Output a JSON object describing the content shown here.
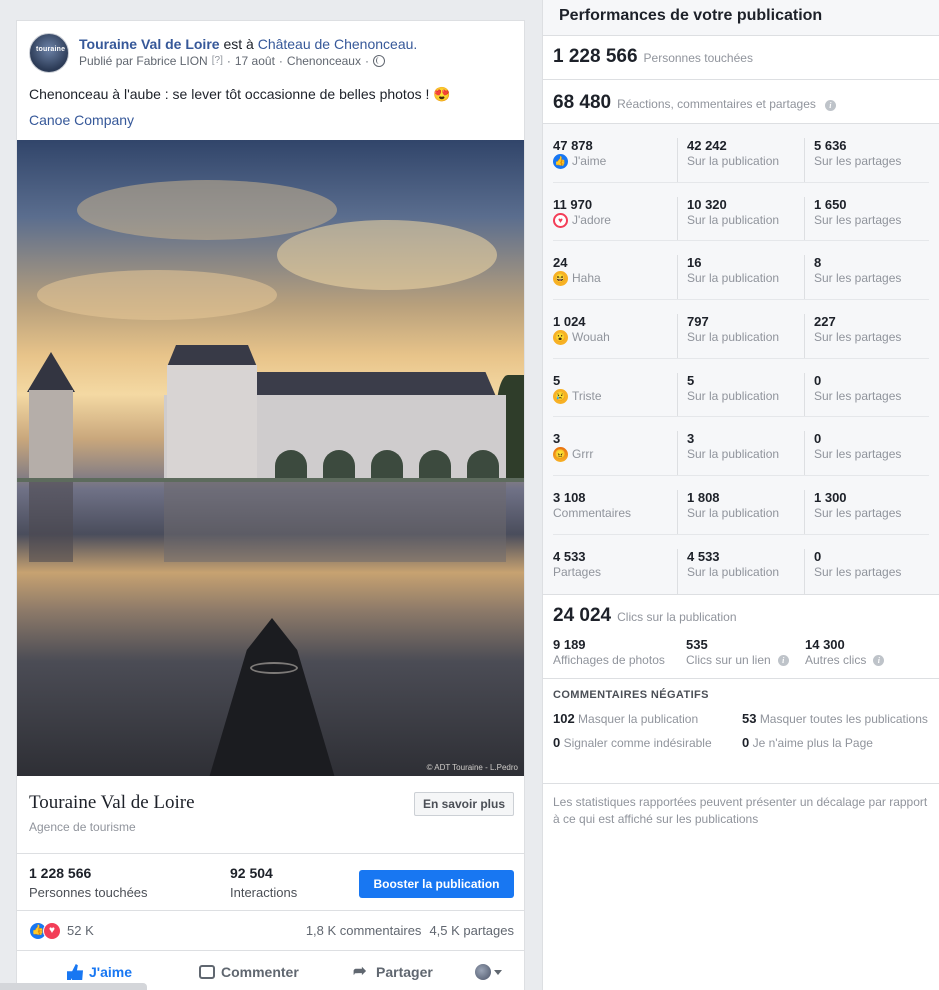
{
  "post": {
    "page_name": "Touraine Val de Loire",
    "avatar_text": "touraine",
    "is_at": "est à",
    "location": "Château de Chenonceau.",
    "published_by": "Publié par Fabrice LION",
    "question_mark": "[?]",
    "date": "17 août",
    "place": "Chenonceaux",
    "sep": "·",
    "message": "Chenonceau à l'aube : se lever tôt occasionne de belles photos ! 😍",
    "tagged": "Canoe Company",
    "photo_credit": "© ADT Touraine - L.Pedro",
    "cta": {
      "name": "Touraine Val de Loire",
      "category": "Agence de tourisme",
      "button": "En savoir plus"
    },
    "stats": {
      "reach_value": "1 228 566",
      "reach_label": "Personnes touchées",
      "interactions_value": "92 504",
      "interactions_label": "Interactions",
      "boost_button": "Booster la publication"
    },
    "reactions": {
      "count": "52 K",
      "comments": "1,8 K commentaires",
      "shares": "4,5 K partages"
    },
    "actions": {
      "like": "J'aime",
      "comment": "Commenter",
      "share": "Partager"
    }
  },
  "panel": {
    "title": "Performances de votre publication",
    "reach": {
      "value": "1 228 566",
      "label": "Personnes touchées"
    },
    "engagement": {
      "value": "68 480",
      "label": "Réactions, commentaires et partages"
    },
    "rows": [
      {
        "total": "47 878",
        "label": "J'aime",
        "icon": "like",
        "on_post": "42 242",
        "on_shares": "5 636"
      },
      {
        "total": "11 970",
        "label": "J'adore",
        "icon": "love",
        "on_post": "10 320",
        "on_shares": "1 650"
      },
      {
        "total": "24",
        "label": "Haha",
        "icon": "haha",
        "on_post": "16",
        "on_shares": "8"
      },
      {
        "total": "1 024",
        "label": "Wouah",
        "icon": "wow",
        "on_post": "797",
        "on_shares": "227"
      },
      {
        "total": "5",
        "label": "Triste",
        "icon": "sad",
        "on_post": "5",
        "on_shares": "0"
      },
      {
        "total": "3",
        "label": "Grrr",
        "icon": "angry",
        "on_post": "3",
        "on_shares": "0"
      },
      {
        "total": "3 108",
        "label": "Commentaires",
        "icon": "",
        "on_post": "1 808",
        "on_shares": "1 300"
      },
      {
        "total": "4 533",
        "label": "Partages",
        "icon": "",
        "on_post": "4 533",
        "on_shares": "0"
      }
    ],
    "on_post_label": "Sur la publication",
    "on_shares_label": "Sur les partages",
    "clicks": {
      "value": "24 024",
      "label": "Clics sur la publication",
      "photo_views": "9 189",
      "photo_views_label": "Affichages de photos",
      "link_clicks": "535",
      "link_clicks_label": "Clics sur un lien",
      "other_clicks": "14 300",
      "other_clicks_label": "Autres clics"
    },
    "negative": {
      "title": "COMMENTAIRES NÉGATIFS",
      "hide_post_value": "102",
      "hide_post_label": "Masquer la publication",
      "hide_all_value": "53",
      "hide_all_label": "Masquer toutes les publications",
      "spam_value": "0",
      "spam_label": "Signaler comme indésirable",
      "unlike_value": "0",
      "unlike_label": "Je n'aime plus la Page"
    },
    "footnote": "Les statistiques rapportées peuvent présenter un décalage par rapport à ce qui est affiché sur les publications"
  },
  "colors": {
    "link": "#365899",
    "accent": "#1877f2",
    "love": "#f33e58",
    "muted": "#90949c"
  }
}
